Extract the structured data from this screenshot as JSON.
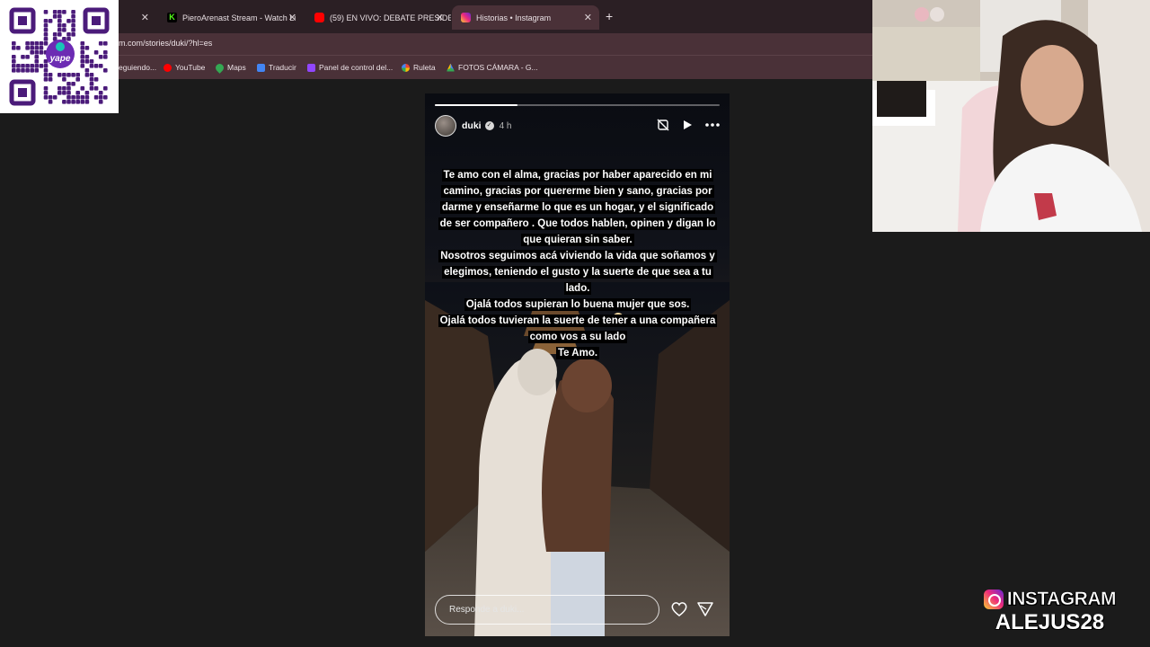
{
  "browser": {
    "tabs": [
      {
        "label": "PieroArenast Stream - Watch Li",
        "favicon_color": "#53fc18"
      },
      {
        "label": "(59) EN VIVO: DEBATE PRESIDE",
        "favicon_color": "#ff0000"
      },
      {
        "label": "Historias • Instagram",
        "favicon_color": "#e1306c"
      }
    ],
    "url": "m.com/stories/duki/?hl=es",
    "bookmarks": [
      {
        "label": "eguiendo..."
      },
      {
        "label": "YouTube",
        "color": "#ff0000"
      },
      {
        "label": "Maps",
        "color": "#34a853"
      },
      {
        "label": "Traducir",
        "color": "#4285f4"
      },
      {
        "label": "Panel de control del...",
        "color": "#9146ff"
      },
      {
        "label": "Ruleta",
        "color": "#fbbc05"
      },
      {
        "label": "FOTOS CÁMARA - G...",
        "color": "#fbbc05"
      }
    ]
  },
  "qr": {
    "brand": "yape"
  },
  "story": {
    "progress": 0.29,
    "username": "duki",
    "time": "4 h",
    "caption": [
      "Te amo con el alma, gracias por haber aparecido en mi camino, gracias por quererme bien y sano, gracias por darme y enseñarme lo que es un hogar, y el significado de ser compañero . Que todos hablen, opinen y digan lo que quieran sin saber.",
      "Nosotros seguimos acá viviendo la vida  que soñamos y elegimos, teniendo el gusto y la suerte de que sea a tu lado.",
      "Ojalá todos supieran lo buena mujer que sos.",
      "Ojalá todos tuvieran la suerte de tener a una compañera como vos a su lado",
      "Te Amo."
    ],
    "reply_placeholder": "Responde a duki..."
  },
  "overlay": {
    "label": "INSTAGRAM",
    "handle": "ALEJUS28"
  }
}
